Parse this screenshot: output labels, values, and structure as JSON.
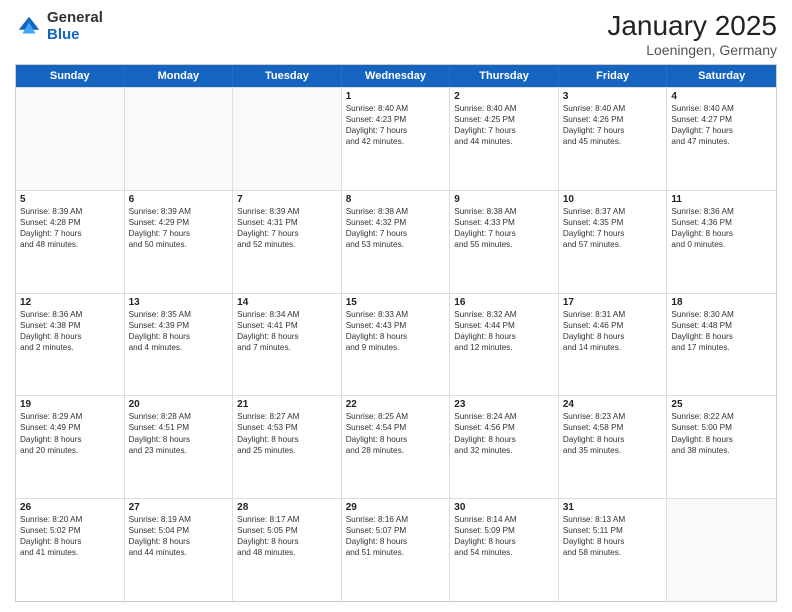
{
  "logo": {
    "general": "General",
    "blue": "Blue"
  },
  "header": {
    "month": "January 2025",
    "location": "Loeningen, Germany"
  },
  "weekdays": [
    "Sunday",
    "Monday",
    "Tuesday",
    "Wednesday",
    "Thursday",
    "Friday",
    "Saturday"
  ],
  "rows": [
    [
      {
        "day": "",
        "info": ""
      },
      {
        "day": "",
        "info": ""
      },
      {
        "day": "",
        "info": ""
      },
      {
        "day": "1",
        "info": "Sunrise: 8:40 AM\nSunset: 4:23 PM\nDaylight: 7 hours\nand 42 minutes."
      },
      {
        "day": "2",
        "info": "Sunrise: 8:40 AM\nSunset: 4:25 PM\nDaylight: 7 hours\nand 44 minutes."
      },
      {
        "day": "3",
        "info": "Sunrise: 8:40 AM\nSunset: 4:26 PM\nDaylight: 7 hours\nand 45 minutes."
      },
      {
        "day": "4",
        "info": "Sunrise: 8:40 AM\nSunset: 4:27 PM\nDaylight: 7 hours\nand 47 minutes."
      }
    ],
    [
      {
        "day": "5",
        "info": "Sunrise: 8:39 AM\nSunset: 4:28 PM\nDaylight: 7 hours\nand 48 minutes."
      },
      {
        "day": "6",
        "info": "Sunrise: 8:39 AM\nSunset: 4:29 PM\nDaylight: 7 hours\nand 50 minutes."
      },
      {
        "day": "7",
        "info": "Sunrise: 8:39 AM\nSunset: 4:31 PM\nDaylight: 7 hours\nand 52 minutes."
      },
      {
        "day": "8",
        "info": "Sunrise: 8:38 AM\nSunset: 4:32 PM\nDaylight: 7 hours\nand 53 minutes."
      },
      {
        "day": "9",
        "info": "Sunrise: 8:38 AM\nSunset: 4:33 PM\nDaylight: 7 hours\nand 55 minutes."
      },
      {
        "day": "10",
        "info": "Sunrise: 8:37 AM\nSunset: 4:35 PM\nDaylight: 7 hours\nand 57 minutes."
      },
      {
        "day": "11",
        "info": "Sunrise: 8:36 AM\nSunset: 4:36 PM\nDaylight: 8 hours\nand 0 minutes."
      }
    ],
    [
      {
        "day": "12",
        "info": "Sunrise: 8:36 AM\nSunset: 4:38 PM\nDaylight: 8 hours\nand 2 minutes."
      },
      {
        "day": "13",
        "info": "Sunrise: 8:35 AM\nSunset: 4:39 PM\nDaylight: 8 hours\nand 4 minutes."
      },
      {
        "day": "14",
        "info": "Sunrise: 8:34 AM\nSunset: 4:41 PM\nDaylight: 8 hours\nand 7 minutes."
      },
      {
        "day": "15",
        "info": "Sunrise: 8:33 AM\nSunset: 4:43 PM\nDaylight: 8 hours\nand 9 minutes."
      },
      {
        "day": "16",
        "info": "Sunrise: 8:32 AM\nSunset: 4:44 PM\nDaylight: 8 hours\nand 12 minutes."
      },
      {
        "day": "17",
        "info": "Sunrise: 8:31 AM\nSunset: 4:46 PM\nDaylight: 8 hours\nand 14 minutes."
      },
      {
        "day": "18",
        "info": "Sunrise: 8:30 AM\nSunset: 4:48 PM\nDaylight: 8 hours\nand 17 minutes."
      }
    ],
    [
      {
        "day": "19",
        "info": "Sunrise: 8:29 AM\nSunset: 4:49 PM\nDaylight: 8 hours\nand 20 minutes."
      },
      {
        "day": "20",
        "info": "Sunrise: 8:28 AM\nSunset: 4:51 PM\nDaylight: 8 hours\nand 23 minutes."
      },
      {
        "day": "21",
        "info": "Sunrise: 8:27 AM\nSunset: 4:53 PM\nDaylight: 8 hours\nand 25 minutes."
      },
      {
        "day": "22",
        "info": "Sunrise: 8:25 AM\nSunset: 4:54 PM\nDaylight: 8 hours\nand 28 minutes."
      },
      {
        "day": "23",
        "info": "Sunrise: 8:24 AM\nSunset: 4:56 PM\nDaylight: 8 hours\nand 32 minutes."
      },
      {
        "day": "24",
        "info": "Sunrise: 8:23 AM\nSunset: 4:58 PM\nDaylight: 8 hours\nand 35 minutes."
      },
      {
        "day": "25",
        "info": "Sunrise: 8:22 AM\nSunset: 5:00 PM\nDaylight: 8 hours\nand 38 minutes."
      }
    ],
    [
      {
        "day": "26",
        "info": "Sunrise: 8:20 AM\nSunset: 5:02 PM\nDaylight: 8 hours\nand 41 minutes."
      },
      {
        "day": "27",
        "info": "Sunrise: 8:19 AM\nSunset: 5:04 PM\nDaylight: 8 hours\nand 44 minutes."
      },
      {
        "day": "28",
        "info": "Sunrise: 8:17 AM\nSunset: 5:05 PM\nDaylight: 8 hours\nand 48 minutes."
      },
      {
        "day": "29",
        "info": "Sunrise: 8:16 AM\nSunset: 5:07 PM\nDaylight: 8 hours\nand 51 minutes."
      },
      {
        "day": "30",
        "info": "Sunrise: 8:14 AM\nSunset: 5:09 PM\nDaylight: 8 hours\nand 54 minutes."
      },
      {
        "day": "31",
        "info": "Sunrise: 8:13 AM\nSunset: 5:11 PM\nDaylight: 8 hours\nand 58 minutes."
      },
      {
        "day": "",
        "info": ""
      }
    ]
  ]
}
